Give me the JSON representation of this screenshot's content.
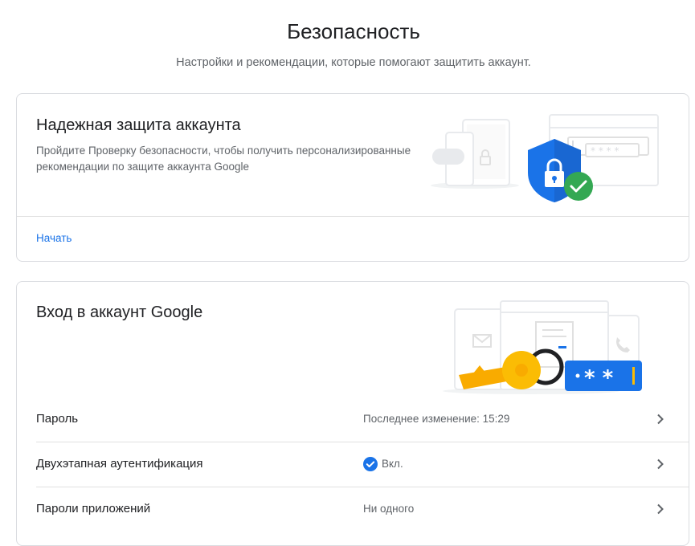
{
  "header": {
    "title": "Безопасность",
    "subtitle": "Настройки и рекомендации, которые помогают защитить аккаунт."
  },
  "security_checkup": {
    "title": "Надежная защита аккаунта",
    "description": "Пройдите Проверку безопасности, чтобы получить персонализированные рекомендации по защите аккаунта Google",
    "start_link": "Начать",
    "illustration": "shield-lock-checkmark-illustration"
  },
  "signin": {
    "title": "Вход в аккаунт Google",
    "illustration": "key-password-devices-illustration",
    "rows": [
      {
        "label": "Пароль",
        "value": "Последнее изменение: 15:29",
        "icon": "chevron-right-icon"
      },
      {
        "label": "Двухэтапная аутентификация",
        "value": "Вкл.",
        "status_icon": "check-circle-icon",
        "icon": "chevron-right-icon"
      },
      {
        "label": "Пароли приложений",
        "value": "Ни одного",
        "icon": "chevron-right-icon"
      }
    ]
  },
  "colors": {
    "accent": "#1a73e8",
    "success": "#34a853",
    "key": "#fbbc04",
    "text_primary": "#202124",
    "text_secondary": "#5f6368"
  }
}
